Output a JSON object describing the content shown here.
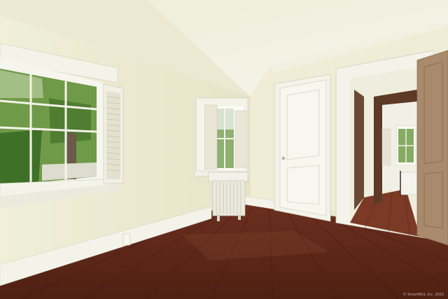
{
  "scene": {
    "watermark": "© SmartMLS, Inc. 2023"
  },
  "colors": {
    "wall_left": "#ecebd2",
    "wall_right": "#efedd6",
    "ceiling": "#f1f0e0",
    "trim": "#f4f3ea",
    "floor": "#6a2e1f",
    "door_natural": "#a98a6c",
    "foliage": "#5e8a3a"
  }
}
